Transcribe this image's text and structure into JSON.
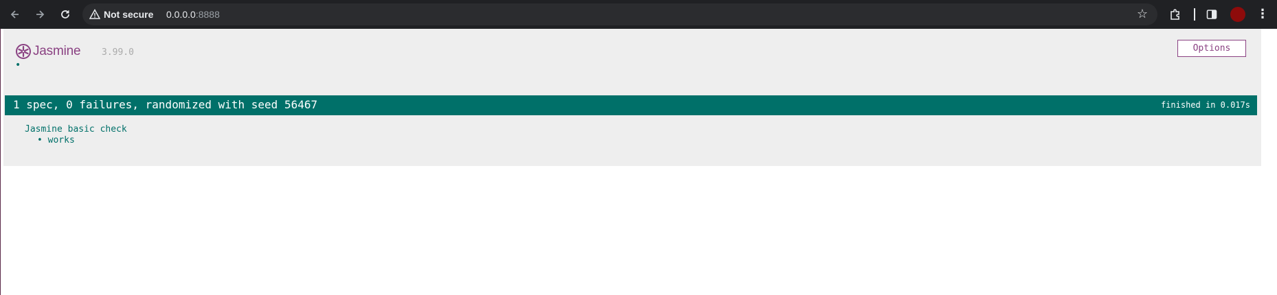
{
  "browser": {
    "security_label": "Not secure",
    "url_host": "0.0.0.0",
    "url_port": ":8888",
    "icons": [
      "back-arrow-icon",
      "forward-arrow-icon",
      "reload-icon",
      "warning-icon",
      "star-icon",
      "extensions-icon",
      "sidebar-icon",
      "profile-avatar",
      "menu-dots-icon"
    ],
    "avatar_color": "#8e0b0b"
  },
  "jasmine": {
    "logo_text": "Jasmine",
    "version": "3.99.0",
    "options_label": "Options",
    "progress_dot": "•",
    "summary": "1 spec, 0 failures, randomized with seed 56467",
    "duration": "finished in 0.017s",
    "suite_name": "Jasmine basic check",
    "specs": [
      {
        "bullet": "•",
        "label": "works"
      }
    ],
    "colors": {
      "brand": "#8a4182",
      "passed": "#007069",
      "background": "#eeeeee"
    }
  }
}
